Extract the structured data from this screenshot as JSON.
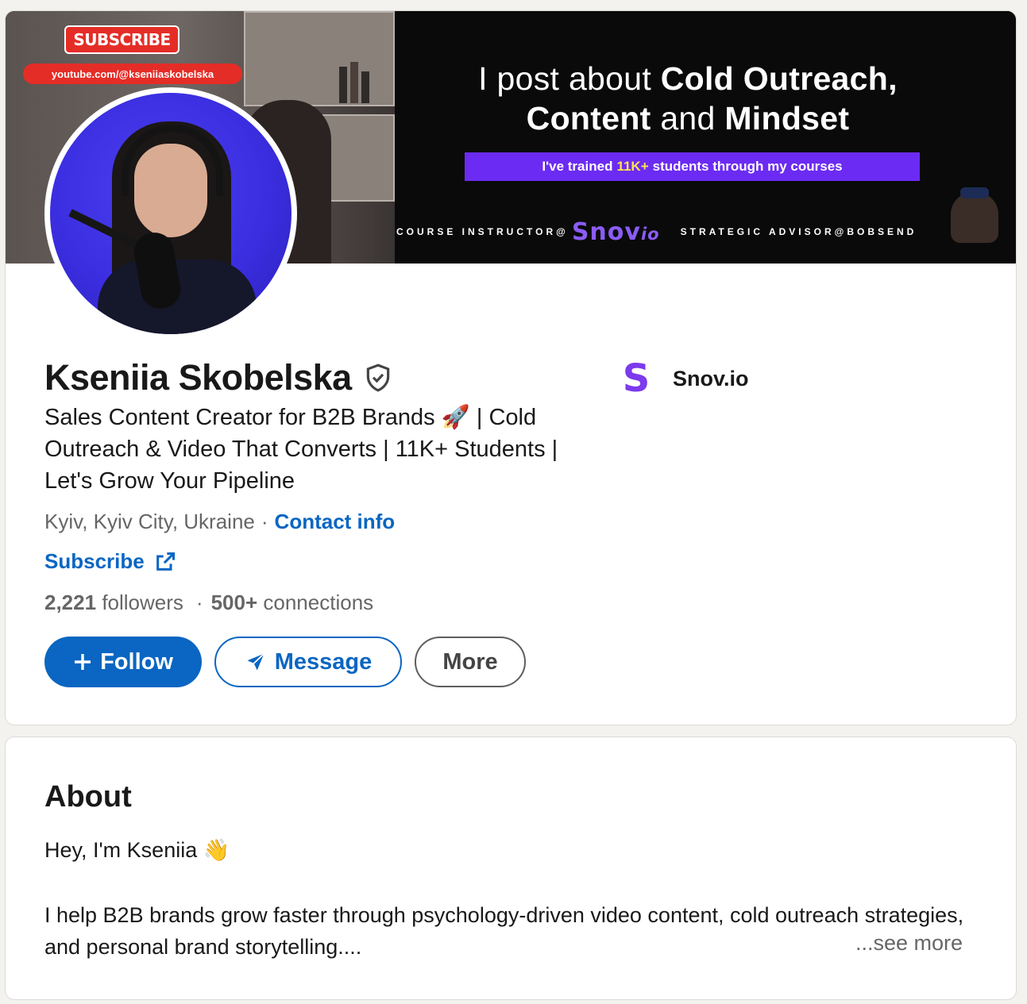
{
  "banner": {
    "subscribe_badge": "SUBSCRIBE",
    "youtube_url": "youtube.com/@kseniiaskobelska",
    "headline_prefix": "I post about ",
    "headline_bold1": "Cold Outreach,",
    "headline_bold2": "Content",
    "headline_and": " and ",
    "headline_bold3": "Mindset",
    "trained_prefix": "I've trained",
    "trained_highlight": "11K+",
    "trained_suffix": "students through my courses",
    "course_instructor": "COURSE INSTRUCTOR@",
    "snovio_logo_main": "Snov",
    "snovio_logo_suffix": "io",
    "strategic_advisor": "STRATEGIC ADVISOR@BOBSEND"
  },
  "profile": {
    "name": "Kseniia Skobelska",
    "headline": "Sales Content Creator for B2B Brands 🚀 | Cold Outreach & Video That Converts | 11K+ Students | Let's Grow Your Pipeline",
    "location": "Kyiv, Kyiv City, Ukraine",
    "location_separator": "·",
    "contact_info": "Contact info",
    "subscribe": "Subscribe",
    "followers_count": "2,221",
    "followers_label": "followers",
    "stats_separator": "·",
    "connections_count": "500+",
    "connections_label": "connections"
  },
  "actions": {
    "follow": "Follow",
    "message": "Message",
    "more": "More"
  },
  "company": {
    "logo_letter": "S",
    "name": "Snov.io"
  },
  "about": {
    "title": "About",
    "greeting": "Hey, I'm Kseniia 👋",
    "body": "I help B2B brands grow faster through psychology-driven video content, cold outreach strategies, and personal brand storytelling....",
    "see_more": "...see more"
  },
  "colors": {
    "linkedin_blue": "#0a66c2",
    "banner_purple": "#6c2bf2",
    "snovio_purple": "#7c3aed",
    "youtube_red": "#e52d27"
  },
  "icons": [
    "shield-icon",
    "external-link-icon",
    "plus-icon",
    "send-icon"
  ]
}
